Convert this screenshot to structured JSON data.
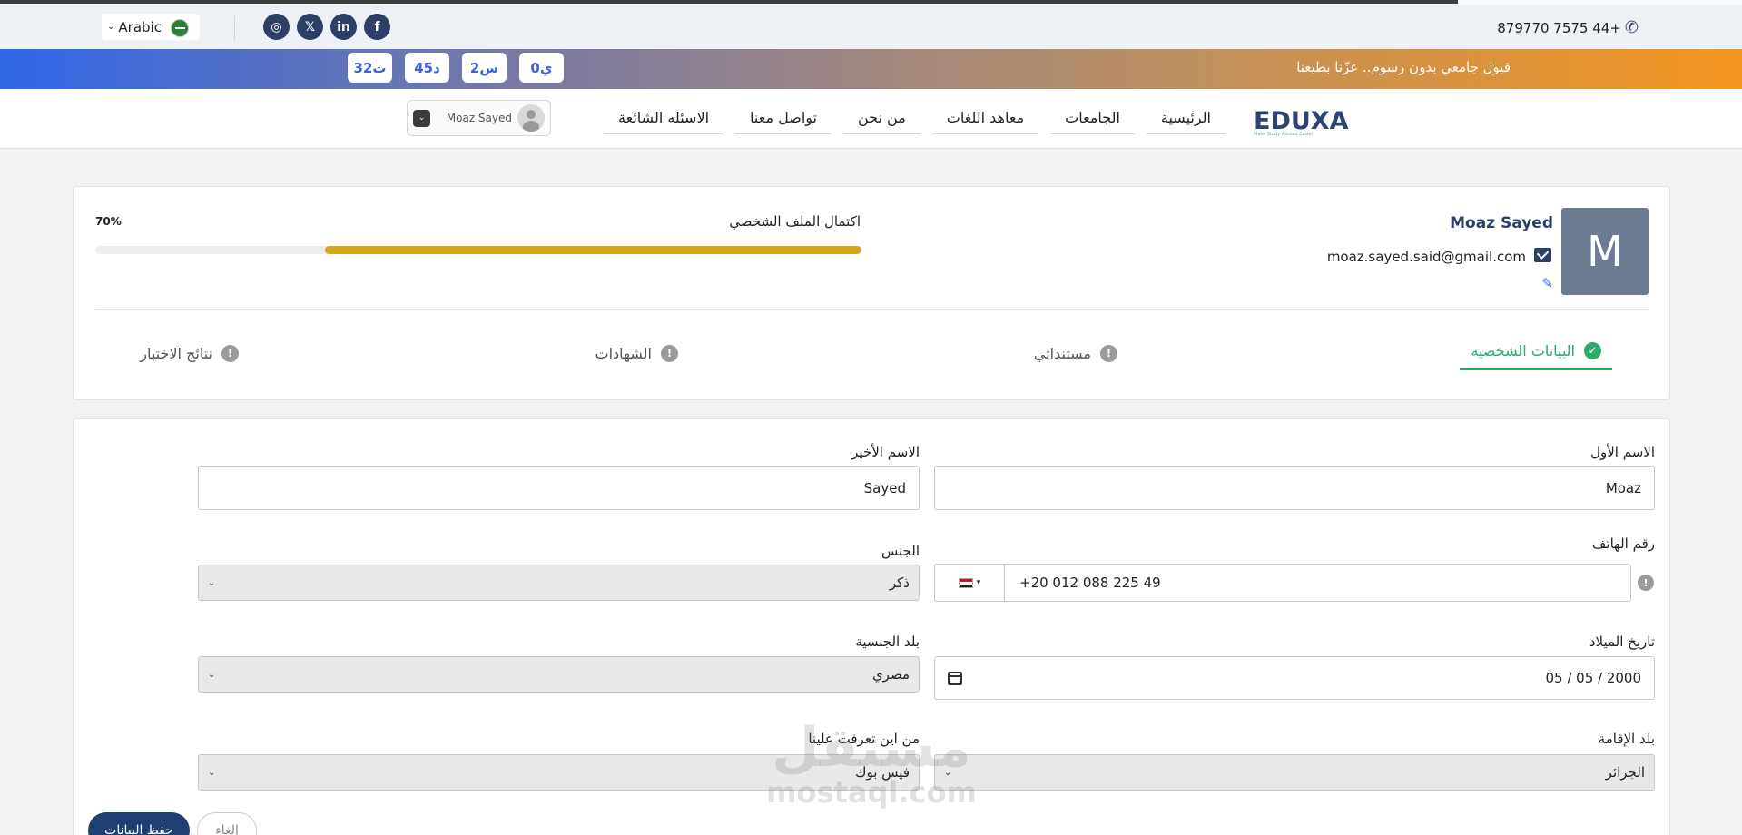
{
  "topbar": {
    "language": "Arabic",
    "phone": "879770 7575 44+",
    "social_icons": [
      "instagram-icon",
      "x-icon",
      "linkedin-icon",
      "facebook-icon"
    ]
  },
  "banner": {
    "slogan": "قبول جامعي بدون رسوم.. عزّنا بطبعنا",
    "countdown": [
      "32ث",
      "45د",
      "2س",
      "0ي"
    ]
  },
  "nav": {
    "logo": "EDUXA",
    "logo_tagline": "Make Study Abroad Easier",
    "items": [
      "الرئيسية",
      "الجامعات",
      "معاهد اللغات",
      "من نحن",
      "تواصل معنا",
      "الاسئله الشائعة"
    ],
    "user_name": "Moaz Sayed"
  },
  "profile": {
    "avatar_letter": "M",
    "name": "Moaz Sayed",
    "email": "moaz.sayed.said@gmail.com",
    "completion_label": "اكتمال الملف الشخصي",
    "completion_percent_text": "70%",
    "completion_fraction": 0.7,
    "progress_color": "#d5a71b"
  },
  "tabs": [
    {
      "label": "البيانات الشخصية",
      "status": "done"
    },
    {
      "label": "مستنداتي",
      "status": "pending"
    },
    {
      "label": "الشهادات",
      "status": "pending"
    },
    {
      "label": "نتائج الاختبار",
      "status": "pending"
    }
  ],
  "form": {
    "first_name_label": "الاسم الأول",
    "first_name_value": "Moaz",
    "last_name_label": "الاسم الأخير",
    "last_name_value": "Sayed",
    "phone_label": "رقم الهاتف",
    "phone_value": "+20 012 088 225 49",
    "gender_label": "الجنس",
    "gender_value": "ذكر",
    "birth_label": "تاريخ الميلاد",
    "birth_value": "05 / 05 / 2000",
    "nationality_label": "بلد الجنسية",
    "nationality_value": "مصري",
    "residence_label": "بلد الإقامة",
    "residence_value": "الجزائر",
    "source_label": "من اين تعرفت علينا",
    "source_value": "فيس بوك",
    "save_label": "حفظ البيانات",
    "cancel_label": "إلغاء"
  },
  "watermark": {
    "arabic": "مستقل",
    "latin": "mostaql.com"
  },
  "colors": {
    "brand": "#2d3f67",
    "accent_green": "#2bab6b",
    "save_button": "#1d3f73"
  }
}
